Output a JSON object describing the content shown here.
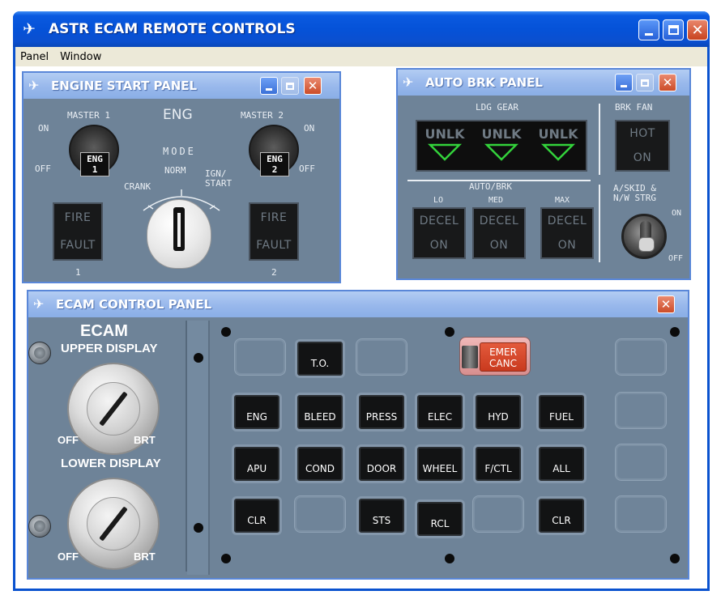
{
  "main": {
    "title": "ASTR ECAM REMOTE CONTROLS",
    "menu": [
      "Panel",
      "Window"
    ]
  },
  "engine_start": {
    "title": "ENGINE START PANEL",
    "eng_label": "ENG",
    "master1": "MASTER 1",
    "master2": "MASTER 2",
    "on": "ON",
    "off": "OFF",
    "eng1_tag": [
      "ENG",
      "1"
    ],
    "eng2_tag": [
      "ENG",
      "2"
    ],
    "mode": "MODE",
    "norm": "NORM",
    "crank": "CRANK",
    "ign": "IGN/",
    "start": "START",
    "fire": "FIRE",
    "fault": "FAULT",
    "num1": "1",
    "num2": "2"
  },
  "auto_brk": {
    "title": "AUTO BRK PANEL",
    "ldg_gear": "LDG GEAR",
    "brk_fan": "BRK FAN",
    "unlk": [
      "UNLK",
      "UNLK",
      "UNLK"
    ],
    "hot": "HOT",
    "on": "ON",
    "auto_brk": "AUTO/BRK",
    "lo": "LO",
    "med": "MED",
    "max": "MAX",
    "decel": "DECEL",
    "askid1": "A/SKID &",
    "askid2": "N/W STRG",
    "on2": "ON",
    "off": "OFF"
  },
  "ecam": {
    "title": "ECAM CONTROL PANEL",
    "heading": "ECAM",
    "upper": "UPPER DISPLAY",
    "lower": "LOWER DISPLAY",
    "off": "OFF",
    "brt": "BRT",
    "to": "T.O.",
    "emer": [
      "EMER",
      "CANC"
    ],
    "row2": [
      "ENG",
      "BLEED",
      "PRESS",
      "ELEC",
      "HYD",
      "FUEL"
    ],
    "row3": [
      "APU",
      "COND",
      "DOOR",
      "WHEEL",
      "F/CTL",
      "ALL"
    ],
    "clr": "CLR",
    "sts": "STS",
    "rcl": "RCL"
  }
}
